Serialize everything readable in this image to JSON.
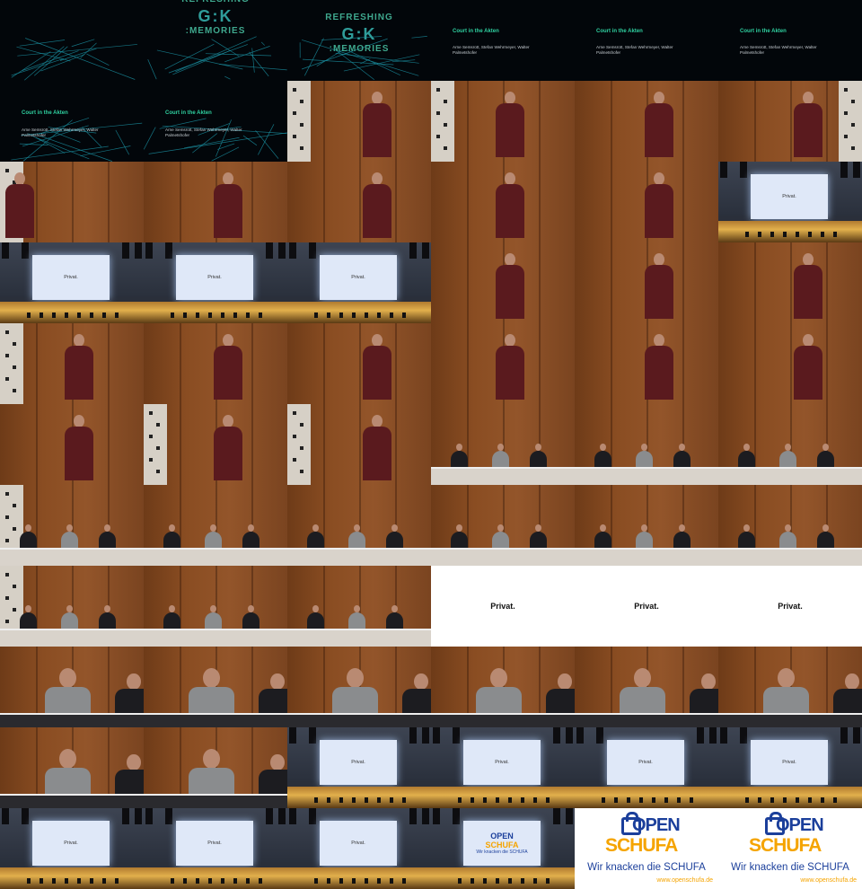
{
  "title_slide": {
    "brand_line_1": "REFRESHING",
    "brand_mark": "G:K",
    "brand_line_2": ":MEMORIES",
    "talk_title": "Court in the Akten",
    "authors": "Arne Semsrott, Stefan Wehrmeyer, Walter Palmetshofer"
  },
  "slide_text": "Privat.",
  "logo": {
    "open": "OPEN",
    "schufa": "SCHUFA",
    "claim": "Wir knacken die SCHUFA",
    "url": "www.openschufa.de"
  },
  "colors": {
    "brand_green": "#2fd0a0",
    "wood": "#8a4d22",
    "open_blue": "#1b3f9b",
    "schufa_orange": "#f5a400"
  },
  "tiles": [
    "title-net",
    "title-brand-top",
    "title-brand",
    "title-info",
    "title-info",
    "title-info",
    "title-info-net",
    "title-info-net",
    "speaker-pillar-left",
    "speaker-pillar-left",
    "speaker",
    "speaker-pillar-right",
    "speaker-left",
    "speaker",
    "speaker",
    "speaker",
    "speaker",
    "stage",
    "stage",
    "stage",
    "stage",
    "speaker",
    "speaker",
    "speaker",
    "speaker-pillar-left",
    "speaker",
    "speaker",
    "speaker",
    "speaker",
    "speaker",
    "speaker",
    "speaker-pillar-left",
    "speaker-pillar-left",
    "panel",
    "panel",
    "panel",
    "panel",
    "panel",
    "panel",
    "panel",
    "panel",
    "panel",
    "panel",
    "panel",
    "panel",
    "white-privat",
    "white-privat",
    "white-privat",
    "close",
    "close",
    "close",
    "close",
    "close",
    "close",
    "close",
    "close",
    "stage",
    "stage",
    "stage",
    "stage",
    "stage",
    "stage",
    "stage",
    "stage-logo",
    "logo",
    "logo"
  ]
}
